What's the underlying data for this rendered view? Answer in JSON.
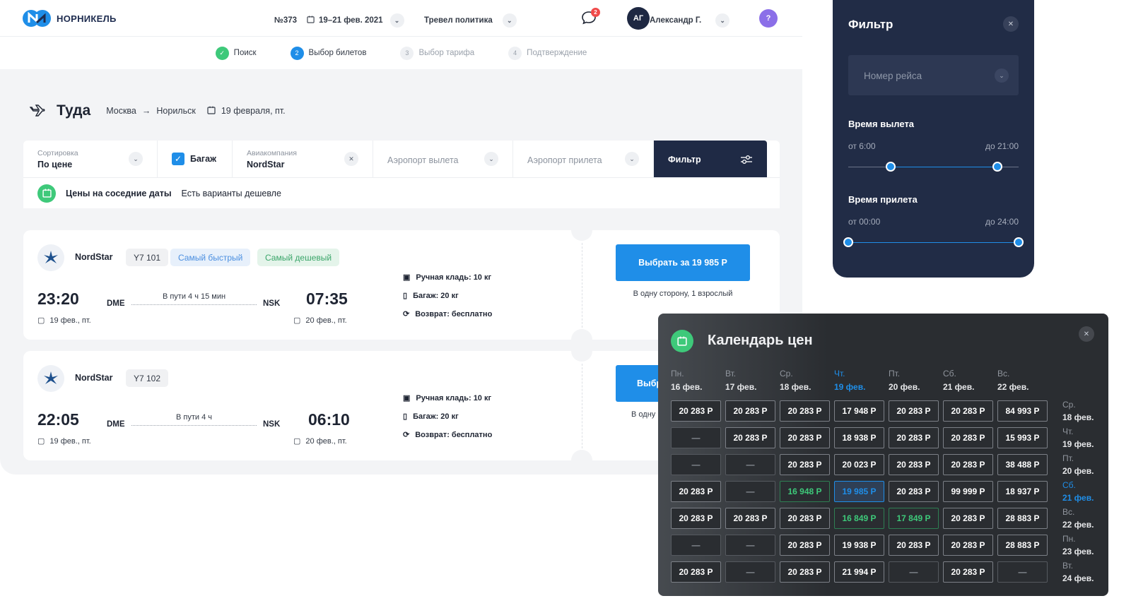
{
  "header": {
    "brand": "НОРНИКЕЛЬ",
    "trip_no": "№373",
    "dates": "19–21 фев. 2021",
    "policy": "Тревел политика",
    "notif_count": "2",
    "avatar_initials": "АГ",
    "user_name": "Александр Г.",
    "help": "?"
  },
  "steps": [
    {
      "num": "✓",
      "label": "Поиск",
      "state": "done"
    },
    {
      "num": "2",
      "label": "Выбор билетов",
      "state": "active"
    },
    {
      "num": "3",
      "label": "Выбор тарифа",
      "state": "todo"
    },
    {
      "num": "4",
      "label": "Подтверждение",
      "state": "todo"
    }
  ],
  "trip": {
    "title": "Туда",
    "from": "Москва",
    "to": "Норильск",
    "date": "19 февраля, пт."
  },
  "filters": {
    "sort_label": "Сортировка",
    "sort_value": "По цене",
    "baggage_label": "Багаж",
    "airline_label": "Авиакомпания",
    "airline_value": "NordStar",
    "dep_airport_ph": "Аэропорт вылета",
    "arr_airport_ph": "Аэропорт прилета",
    "filter_button": "Фильтр"
  },
  "near_dates": {
    "title": "Цены на соседние даты",
    "text": "Есть варианты дешевле"
  },
  "flights": [
    {
      "airline": "NordStar",
      "flight_no": "Y7 101",
      "tags": [
        "Самый быстрый",
        "Самый дешевый"
      ],
      "dep_time": "23:20",
      "dep_code": "DME",
      "dep_date": "19 фев., пт.",
      "duration": "В пути 4 ч 15 мин",
      "arr_time": "07:35",
      "arr_code": "NSK",
      "arr_date": "20 фев., пт.",
      "hand": "Ручная кладь: 10 кг",
      "baggage": "Багаж: 20 кг",
      "refund": "Возврат: бесплатно",
      "buy": "Выбрать за 19 985 Р",
      "note": "В одну сторону, 1 взрослый"
    },
    {
      "airline": "NordStar",
      "flight_no": "Y7 102",
      "tags": [],
      "dep_time": "22:05",
      "dep_code": "DME",
      "dep_date": "19 фев., пт.",
      "duration": "В пути 4 ч",
      "arr_time": "06:10",
      "arr_code": "NSK",
      "arr_date": "20 фев., пт.",
      "hand": "Ручная кладь: 10 кг",
      "baggage": "Багаж: 20 кг",
      "refund": "Возврат: бесплатно",
      "buy": "Выбр",
      "note": "В одну"
    }
  ],
  "filter_panel": {
    "title": "Фильтр",
    "flight_no_ph": "Номер рейса",
    "dep_title": "Время вылета",
    "dep_from": "от 6:00",
    "dep_to": "до 21:00",
    "dep_range": [
      0.25,
      0.875
    ],
    "arr_title": "Время прилета",
    "arr_from": "от 00:00",
    "arr_to": "до 24:00",
    "arr_range": [
      0,
      1
    ]
  },
  "calendar": {
    "title": "Календарь цен",
    "columns": [
      {
        "dow": "Пн.",
        "date": "16 фев."
      },
      {
        "dow": "Вт.",
        "date": "17 фев."
      },
      {
        "dow": "Ср.",
        "date": "18 фев."
      },
      {
        "dow": "Чт.",
        "date": "19 фев.",
        "highlight": true
      },
      {
        "dow": "Пт.",
        "date": "20 фев."
      },
      {
        "dow": "Сб.",
        "date": "21 фев."
      },
      {
        "dow": "Вс.",
        "date": "22 фев."
      }
    ],
    "rows": [
      {
        "dow": "Ср.",
        "date": "18 фев."
      },
      {
        "dow": "Чт.",
        "date": "19 фев."
      },
      {
        "dow": "Пт.",
        "date": "20 фев."
      },
      {
        "dow": "Сб.",
        "date": "21 фев.",
        "highlight": true
      },
      {
        "dow": "Вс.",
        "date": "22 фев."
      },
      {
        "dow": "Пн.",
        "date": "23 фев."
      },
      {
        "dow": "Вт.",
        "date": "24 фев."
      }
    ],
    "cells": [
      [
        "20 283 Р",
        "20 283 Р",
        "20 283 Р",
        "17 948 Р",
        "20 283 Р",
        "20 283 Р",
        "84 993 Р"
      ],
      [
        "—",
        "20 283 Р",
        "20 283 Р",
        "18 938 Р",
        "20 283 Р",
        "20 283 Р",
        "15 993 Р"
      ],
      [
        "—",
        "—",
        "20 283 Р",
        "20 023 Р",
        "20 283 Р",
        "20 283 Р",
        "38 488 Р"
      ],
      [
        "20 283 Р",
        "—",
        "16 948 Р",
        "19 985 Р",
        "20 283 Р",
        "99 999 Р",
        "18 937 Р"
      ],
      [
        "20 283 Р",
        "20 283 Р",
        "20 283 Р",
        "16 849 Р",
        "17 849 Р",
        "20 283 Р",
        "28 883 Р"
      ],
      [
        "—",
        "—",
        "20 283 Р",
        "19 938 Р",
        "20 283 Р",
        "20 283 Р",
        "28 883 Р"
      ],
      [
        "20 283 Р",
        "—",
        "20 283 Р",
        "21 994 Р",
        "—",
        "20 283 Р",
        "—"
      ]
    ],
    "green_cells": [
      [
        3,
        2
      ],
      [
        4,
        3
      ],
      [
        4,
        4
      ]
    ],
    "selected_cell": [
      3,
      3
    ]
  }
}
